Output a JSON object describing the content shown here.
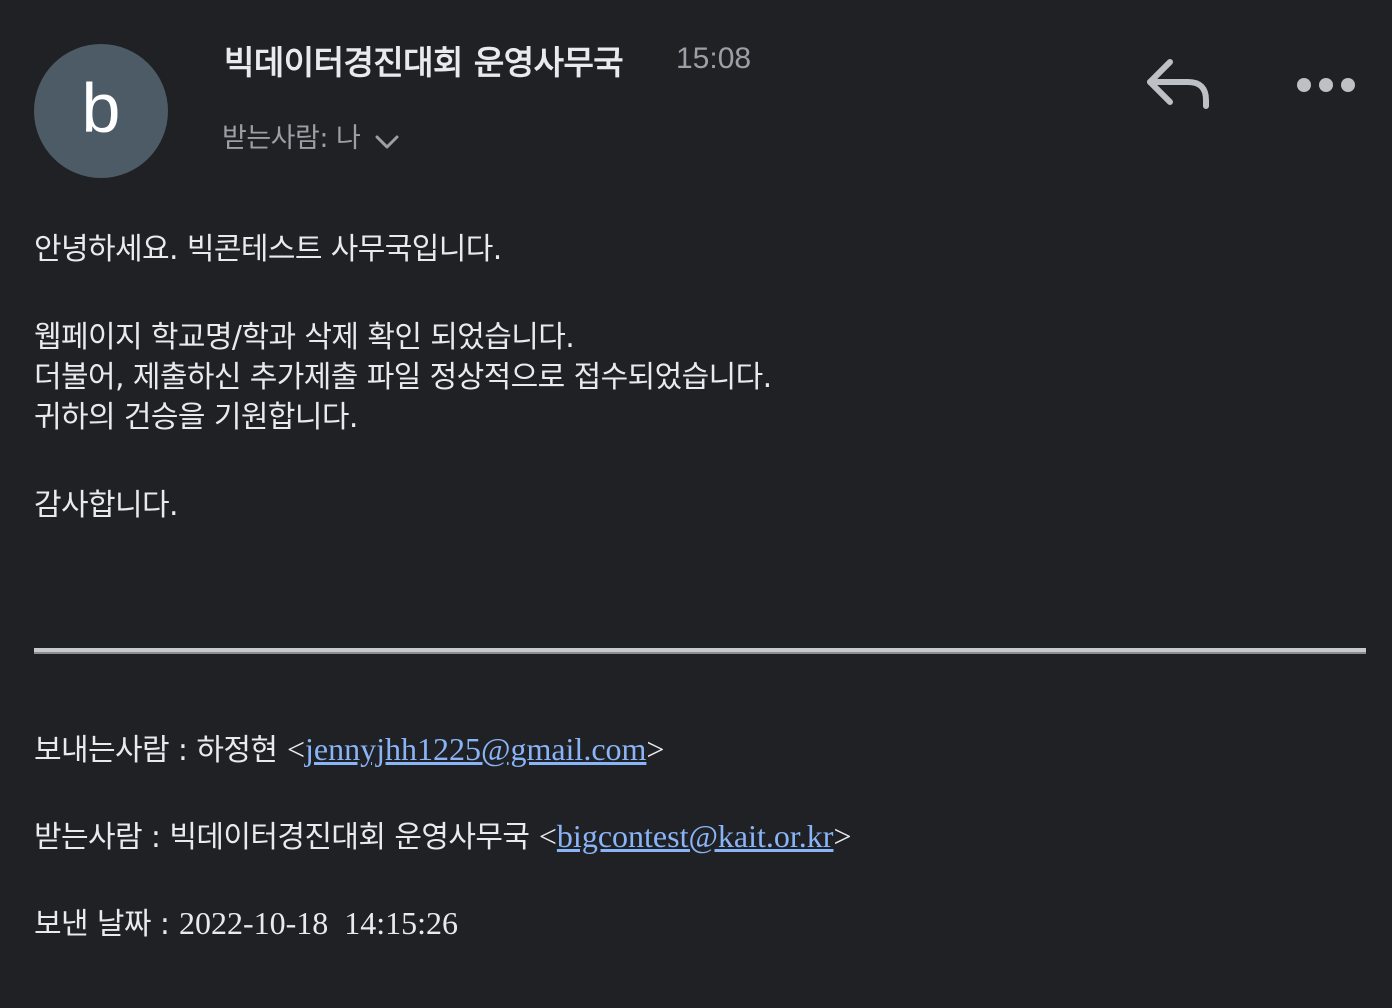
{
  "header": {
    "avatar_letter": "b",
    "sender_name": "빅데이터경진대회 운영사무국",
    "time": "15:08",
    "recipient_label": "받는사람: 나",
    "icons": [
      "reply-icon",
      "more-options-icon",
      "chevron-down-icon"
    ]
  },
  "body": {
    "greeting": "안녕하세요. 빅콘테스트 사무국입니다.",
    "line1": "웹페이지 학교명/학과 삭제 확인 되었습니다.",
    "line2": "더불어, 제출하신 추가제출 파일 정상적으로 접수되었습니다.",
    "line3": "귀하의 건승을 기원합니다.",
    "closing": "감사합니다."
  },
  "quoted": {
    "from_label": "보내는사람 : 하정현",
    "from_email": "jennyjhh1225@gmail.com",
    "to_label": "받는사람 : 빅데이터경진대회 운영사무국",
    "to_email": "bigcontest@kait.or.kr",
    "date_label": "보낸 날짜 :",
    "date_value": "2022-10-18  14:15:26",
    "open_bracket": "<",
    "close_bracket": ">"
  },
  "colors": {
    "background": "#202124",
    "avatar": "#4d5b67",
    "link": "#8ab4f8",
    "secondary_text": "#9aa0a6"
  }
}
